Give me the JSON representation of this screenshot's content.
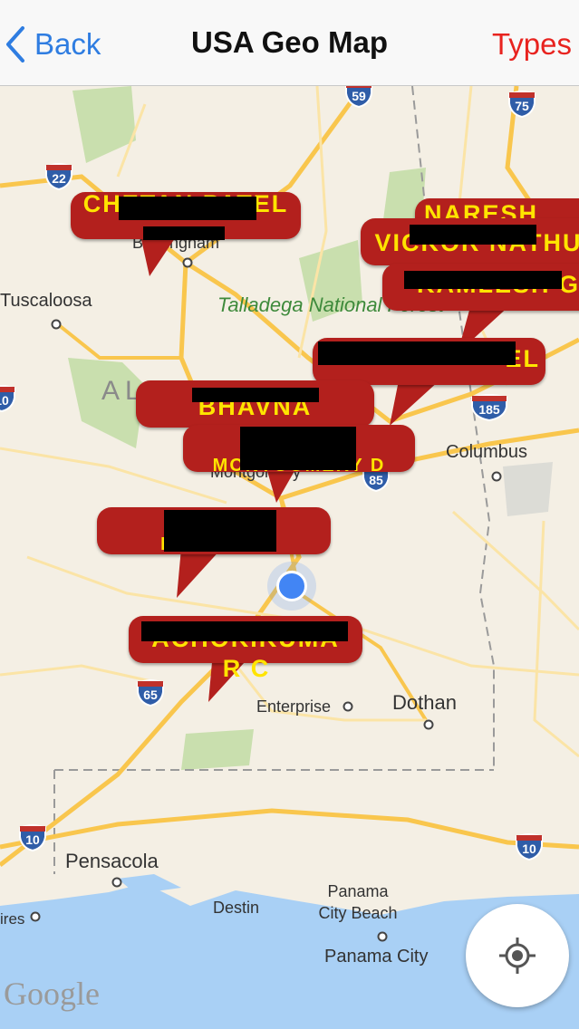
{
  "nav": {
    "back_label": "Back",
    "title": "USA Geo Map",
    "types_label": "Types"
  },
  "map": {
    "places": {
      "tuscaloosa": "Tuscaloosa",
      "columbus": "Columbus",
      "enterprise": "Enterprise",
      "dothan": "Dothan",
      "pensacola": "Pensacola",
      "destin": "Destin",
      "panama_city_beach": "Panama City Beach",
      "panama_city": "Panama City",
      "ires": "ires",
      "montgomery": "Montgomery",
      "birmingham": "Birmingham"
    },
    "forest": "Talladega National Forest",
    "state": "ALABAMA",
    "shields": {
      "i22": "22",
      "i59": "59",
      "i75": "75",
      "i85": "85",
      "i185": "185",
      "i65": "65",
      "i10_west": "10",
      "i10_east": "10",
      "i10_left": "10"
    },
    "attribution": "Google"
  },
  "markers": [
    {
      "text": "CHETAN PATEL"
    },
    {
      "text": "NARESH"
    },
    {
      "text": "VICKOR NATHU"
    },
    {
      "text": "KAMLESH G"
    },
    {
      "text": "EL"
    },
    {
      "text": "BHAVNA"
    },
    {
      "text": "MONTGOMERY D"
    },
    {
      "text": "NATIONAL"
    },
    {
      "text": "ACHOKIKUMA"
    },
    {
      "text": "R C"
    }
  ],
  "colors": {
    "ios_blue": "#2f7de1",
    "types_red": "#e8231f",
    "marker_red": "#b3201d",
    "marker_text": "#ffe400",
    "water": "#a9d0f5",
    "land": "#f4efe4",
    "park": "#c9dfae",
    "road": "#f9c64d"
  },
  "icons": {
    "back": "chevron-left-icon",
    "locate": "my-location-icon",
    "city": "city-dot-icon"
  }
}
